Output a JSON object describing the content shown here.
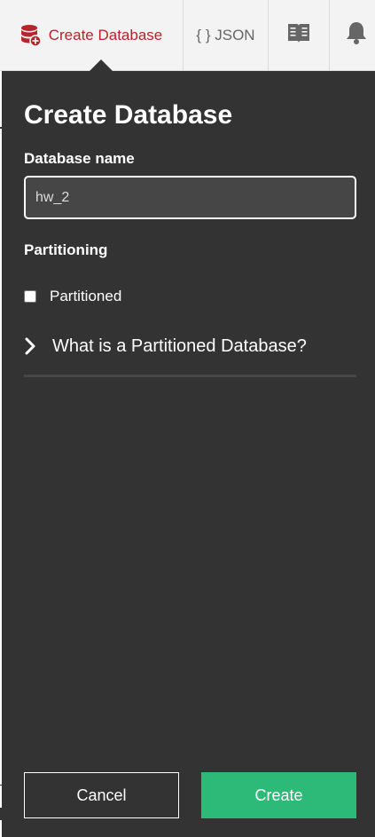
{
  "toolbar": {
    "create_label": "Create Database",
    "create_icon": "database-add-icon",
    "json_label": "{ } JSON",
    "docs_icon": "book-icon",
    "bell_icon": "bell-icon",
    "accent_color": "#b2262c"
  },
  "panel": {
    "title": "Create Database",
    "name_label": "Database name",
    "name_value": "hw_2",
    "partitioning_label": "Partitioning",
    "partitioned_label": "Partitioned",
    "partitioned_checked": false,
    "expander_label": "What is a Partitioned Database?",
    "cancel_label": "Cancel",
    "create_label": "Create",
    "create_color": "#2dba78"
  }
}
